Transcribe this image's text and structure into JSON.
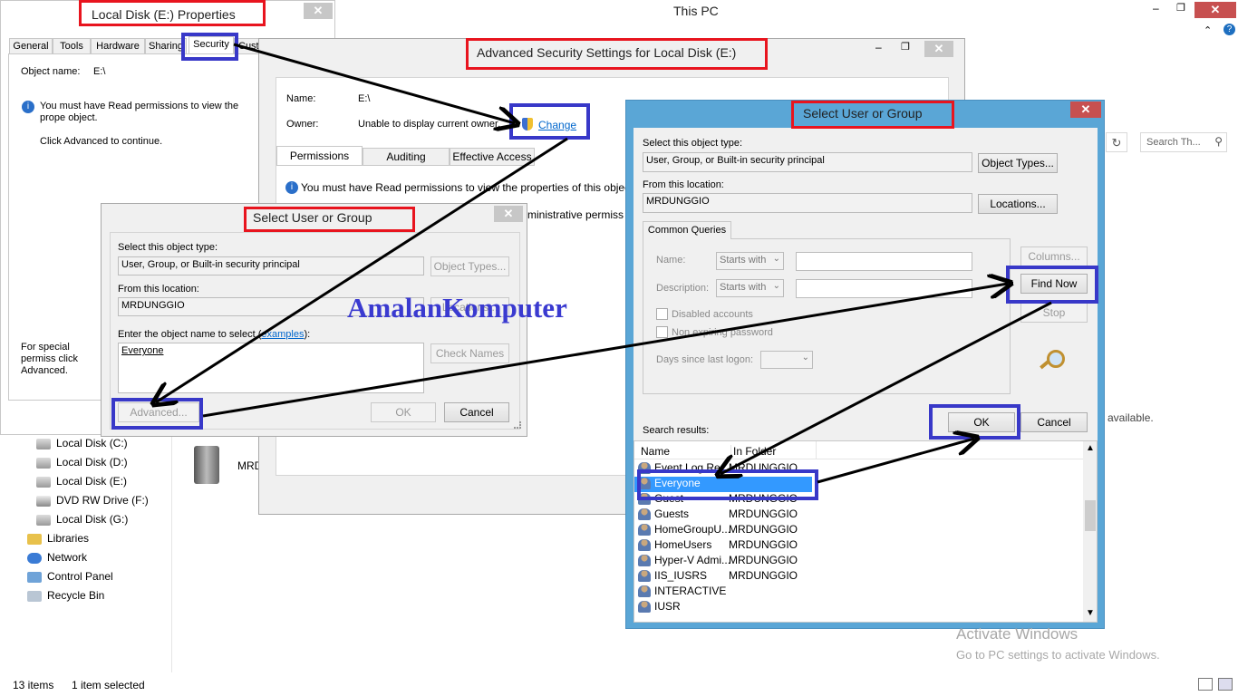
{
  "explorer": {
    "title": "This PC",
    "search_placeholder": "Search Th...",
    "drive_partial": "MRD",
    "available_partial": "available.",
    "nav": [
      {
        "label": "Local Disk (C:)",
        "icon": "drive-icon"
      },
      {
        "label": "Local Disk (D:)",
        "icon": "drive-icon"
      },
      {
        "label": "Local Disk (E:)",
        "icon": "drive-icon"
      },
      {
        "label": "DVD RW Drive (F:)",
        "icon": "dvd-drive-icon"
      },
      {
        "label": "Local Disk (G:)",
        "icon": "drive-icon"
      },
      {
        "label": "Libraries",
        "icon": "libraries-icon"
      },
      {
        "label": "Network",
        "icon": "network-icon"
      },
      {
        "label": "Control Panel",
        "icon": "control-panel-icon"
      },
      {
        "label": "Recycle Bin",
        "icon": "recycle-bin-icon"
      }
    ],
    "status_items": "13 items",
    "status_selected": "1 item selected"
  },
  "properties": {
    "title": "Local Disk (E:) Properties",
    "tabs": [
      "General",
      "Tools",
      "Hardware",
      "Sharing",
      "Security",
      "Cust"
    ],
    "object_name_label": "Object name:",
    "object_name_value": "E:\\",
    "info_text": "You must have Read permissions to view the prope object.",
    "advanced_hint": "Click Advanced to continue.",
    "special_text": "For special permiss click Advanced."
  },
  "advanced": {
    "title": "Advanced Security Settings for Local Disk (E:)",
    "name_label": "Name:",
    "name_value": "E:\\",
    "owner_label": "Owner:",
    "owner_value": "Unable to display current owner.",
    "change_link": "Change",
    "tabs": [
      "Permissions",
      "Auditing",
      "Effective Access"
    ],
    "info_text": "You must have Read permissions to view the properties of this object",
    "admin_partial": "ministrative permiss"
  },
  "select_small": {
    "title": "Select User or Group",
    "object_type_label": "Select this object type:",
    "object_type_value": "User, Group, or Built-in security principal",
    "object_types_btn": "Object Types...",
    "location_label": "From this location:",
    "location_value": "MRDUNGGIO",
    "locations_btn": "Locations...",
    "enter_label": "Enter the object name to select (",
    "examples_link": "examples",
    "enter_label_end": "):",
    "entered_value": "Everyone",
    "check_names_btn": "Check Names",
    "advanced_btn": "Advanced...",
    "ok_btn": "OK",
    "cancel_btn": "Cancel"
  },
  "watermark": "AmalanKomputer",
  "select_large": {
    "title": "Select User or Group",
    "object_type_label": "Select this object type:",
    "object_type_value": "User, Group, or Built-in security principal",
    "object_types_btn": "Object Types...",
    "location_label": "From this location:",
    "location_value": "MRDUNGGIO",
    "locations_btn": "Locations...",
    "queries_tab": "Common Queries",
    "name_label": "Name:",
    "description_label": "Description:",
    "starts_with": "Starts with",
    "columns_btn": "Columns...",
    "find_now_btn": "Find Now",
    "stop_btn": "Stop",
    "disabled_accounts": "Disabled accounts",
    "non_expiring": "Non expiring password",
    "days_label": "Days since last logon:",
    "ok_btn": "OK",
    "cancel_btn": "Cancel",
    "search_results_label": "Search results:",
    "col_name": "Name",
    "col_folder": "In Folder",
    "results": [
      {
        "name": "Event Log Re...",
        "folder": "MRDUNGGIO"
      },
      {
        "name": "Everyone",
        "folder": ""
      },
      {
        "name": "Guest",
        "folder": "MRDUNGGIO"
      },
      {
        "name": "Guests",
        "folder": "MRDUNGGIO"
      },
      {
        "name": "HomeGroupU...",
        "folder": "MRDUNGGIO"
      },
      {
        "name": "HomeUsers",
        "folder": "MRDUNGGIO"
      },
      {
        "name": "Hyper-V Admi...",
        "folder": "MRDUNGGIO"
      },
      {
        "name": "IIS_IUSRS",
        "folder": "MRDUNGGIO"
      },
      {
        "name": "INTERACTIVE",
        "folder": ""
      },
      {
        "name": "IUSR",
        "folder": ""
      }
    ]
  },
  "activation": {
    "title": "Activate Windows",
    "subtitle": "Go to PC settings to activate Windows."
  },
  "colors": {
    "highlight_red": "#e8141e",
    "highlight_blue": "#3838c8",
    "dialog_frame": "#5aa6d6",
    "close_red": "#c75050"
  }
}
